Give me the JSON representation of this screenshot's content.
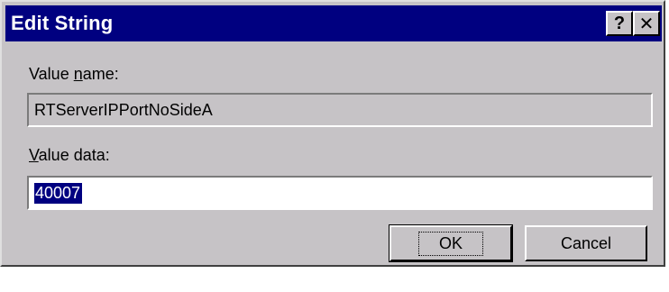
{
  "window": {
    "title": "Edit String",
    "help_label": "?",
    "close_label": "✕",
    "colors": {
      "titlebar": "#000080",
      "face": "#c6c3c6",
      "selection": "#000080"
    }
  },
  "form": {
    "value_name_label_prefix": "Value ",
    "value_name_label_accel": "n",
    "value_name_label_suffix": "ame:",
    "value_name": "RTServerIPPortNoSideA",
    "value_data_label_accel": "V",
    "value_data_label_suffix": "alue data:",
    "value_data": "40007"
  },
  "buttons": {
    "ok": "OK",
    "cancel": "Cancel"
  }
}
